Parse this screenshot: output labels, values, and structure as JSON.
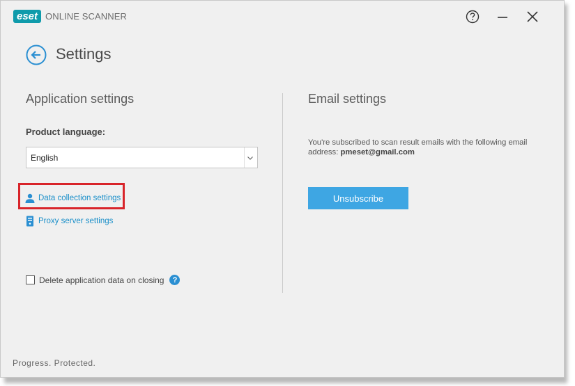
{
  "app": {
    "logo_mark": "eset",
    "product_name": "ONLINE SCANNER",
    "brand_color": "#0f9bab",
    "window_controls": {
      "help_icon": "question-circle-icon",
      "minimize_icon": "minimize-icon",
      "close_icon": "close-icon"
    }
  },
  "page": {
    "back_icon": "back-arrow-circle-icon",
    "title": "Settings"
  },
  "application_settings": {
    "heading": "Application settings",
    "language_label": "Product language:",
    "language_value": "English",
    "links": [
      {
        "label": "Data collection settings",
        "icon": "user-icon",
        "highlighted": true
      },
      {
        "label": "Proxy server settings",
        "icon": "server-icon",
        "highlighted": false
      }
    ],
    "delete_checkbox": {
      "label": "Delete application data on closing",
      "checked": false,
      "help_icon": "help-icon"
    }
  },
  "email_settings": {
    "heading": "Email settings",
    "description": "You're subscribed to scan result emails with the following email address:",
    "email": "pmeset@gmail.com",
    "button_label": "Unsubscribe",
    "button_color": "#3ea6e3"
  },
  "footer": {
    "tagline": "Progress. Protected."
  },
  "colors": {
    "link": "#1a8fc9",
    "highlight_border": "#d8242a",
    "background": "#f0f0f0"
  }
}
